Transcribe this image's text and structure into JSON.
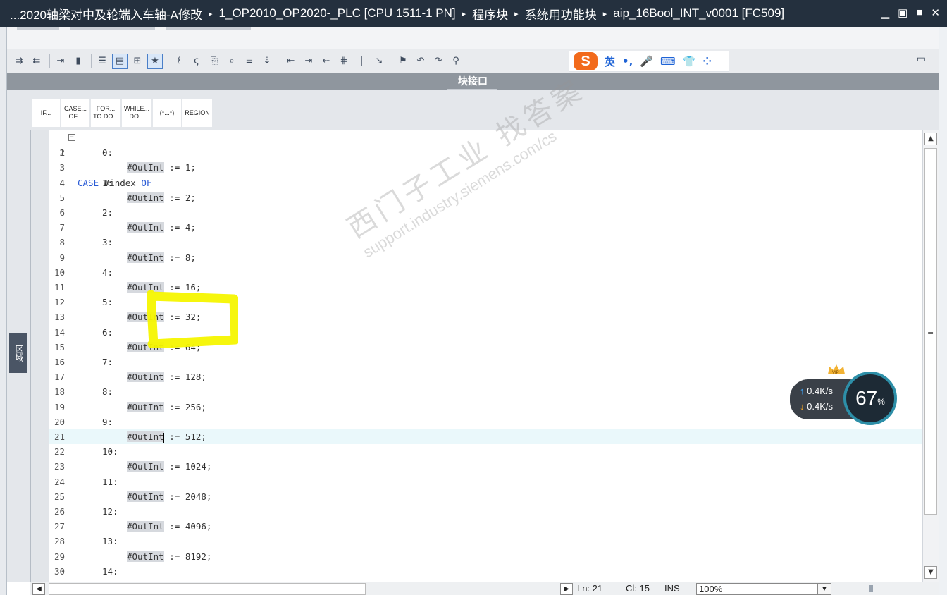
{
  "title": {
    "crumbs": [
      "...2020轴梁对中及轮端入车轴-A修改",
      "1_OP2010_OP2020-_PLC [CPU 1511-1 PN]",
      "程序块",
      "系统用功能块",
      "aip_16Bool_INT_v0001 [FC509]"
    ],
    "separator": "▸",
    "window_controls": [
      "▁",
      "▣",
      "■",
      "✕"
    ]
  },
  "toolbar": {
    "icons": [
      "insert-network-icon",
      "delete-network-icon",
      "insert-row-icon",
      "clear-icon",
      "absolute-icon",
      "symbolic-icon",
      "monitor-icon",
      "favorite-icon",
      "breakpoint-icon",
      "breakpoint-clear-icon",
      "step-icon",
      "watch-icon",
      "comment-icon",
      "compile-icon",
      "indent-icon",
      "outdent-icon",
      "align-icon",
      "format-icon",
      "bookmark-icon",
      "go-icon",
      "goto-icon",
      "prev-icon",
      "next-icon",
      "search-icon"
    ],
    "ime": {
      "logo": "S",
      "lang": "英",
      "items": [
        "•,",
        "🎤",
        "⌨",
        "👕",
        "⁘"
      ]
    }
  },
  "interface_bar": {
    "label": "块接口"
  },
  "palette": [
    {
      "line1": "IF...",
      "line2": ""
    },
    {
      "line1": "CASE...",
      "line2": "OF..."
    },
    {
      "line1": "FOR...",
      "line2": "TO DO..."
    },
    {
      "line1": "WHILE...",
      "line2": "DO..."
    },
    {
      "line1": "(*...*)",
      "line2": ""
    },
    {
      "line1": "REGION",
      "line2": ""
    }
  ],
  "code": {
    "line1": {
      "kw1": "CASE",
      "var": "#index",
      "kw2": "OF"
    },
    "lines": [
      {
        "n": "2",
        "case": "0:"
      },
      {
        "n": "3",
        "var": "#OutInt",
        "val": "1"
      },
      {
        "n": "4",
        "case": "1:"
      },
      {
        "n": "5",
        "var": "#OutInt",
        "val": "2"
      },
      {
        "n": "6",
        "case": "2:"
      },
      {
        "n": "7",
        "var": "#OutInt",
        "val": "4"
      },
      {
        "n": "8",
        "case": "3:"
      },
      {
        "n": "9",
        "var": "#OutInt",
        "val": "8"
      },
      {
        "n": "10",
        "case": "4:"
      },
      {
        "n": "11",
        "var": "#OutInt",
        "val": "16"
      },
      {
        "n": "12",
        "case": "5:"
      },
      {
        "n": "13",
        "var": "#OutInt",
        "val": "32"
      },
      {
        "n": "14",
        "case": "6:"
      },
      {
        "n": "15",
        "var": "#OutInt",
        "val": "64"
      },
      {
        "n": "16",
        "case": "7:"
      },
      {
        "n": "17",
        "var": "#OutInt",
        "val": "128"
      },
      {
        "n": "18",
        "case": "8:"
      },
      {
        "n": "19",
        "var": "#OutInt",
        "val": "256"
      },
      {
        "n": "20",
        "case": "9:"
      },
      {
        "n": "21",
        "var": "#OutInt",
        "val": "512"
      },
      {
        "n": "22",
        "case": "10:"
      },
      {
        "n": "23",
        "var": "#OutInt",
        "val": "1024"
      },
      {
        "n": "24",
        "case": "11:"
      },
      {
        "n": "25",
        "var": "#OutInt",
        "val": "2048"
      },
      {
        "n": "26",
        "case": "12:"
      },
      {
        "n": "27",
        "var": "#OutInt",
        "val": "4096"
      },
      {
        "n": "28",
        "case": "13:"
      },
      {
        "n": "29",
        "var": "#OutInt",
        "val": "8192"
      },
      {
        "n": "30",
        "case": "14:"
      }
    ],
    "assign_op": ":=",
    "current_line": "21"
  },
  "watermark": {
    "line1": "西门子工业 找答案",
    "line2": "support.industry.siemens.com/cs"
  },
  "statusbar": {
    "ln": "Ln: 21",
    "cl": "Cl: 15",
    "mode": "INS",
    "zoom": "100%"
  },
  "left_panel": {
    "tab_label": "区域"
  },
  "net_widget": {
    "up": "0.4K/s",
    "down": "0.4K/s",
    "percent": "67",
    "percent_unit": "%",
    "badge": "VIP"
  },
  "colors": {
    "title_bg": "#24303e",
    "keyword": "#2a5bd6",
    "highlight": "#f5f500"
  }
}
